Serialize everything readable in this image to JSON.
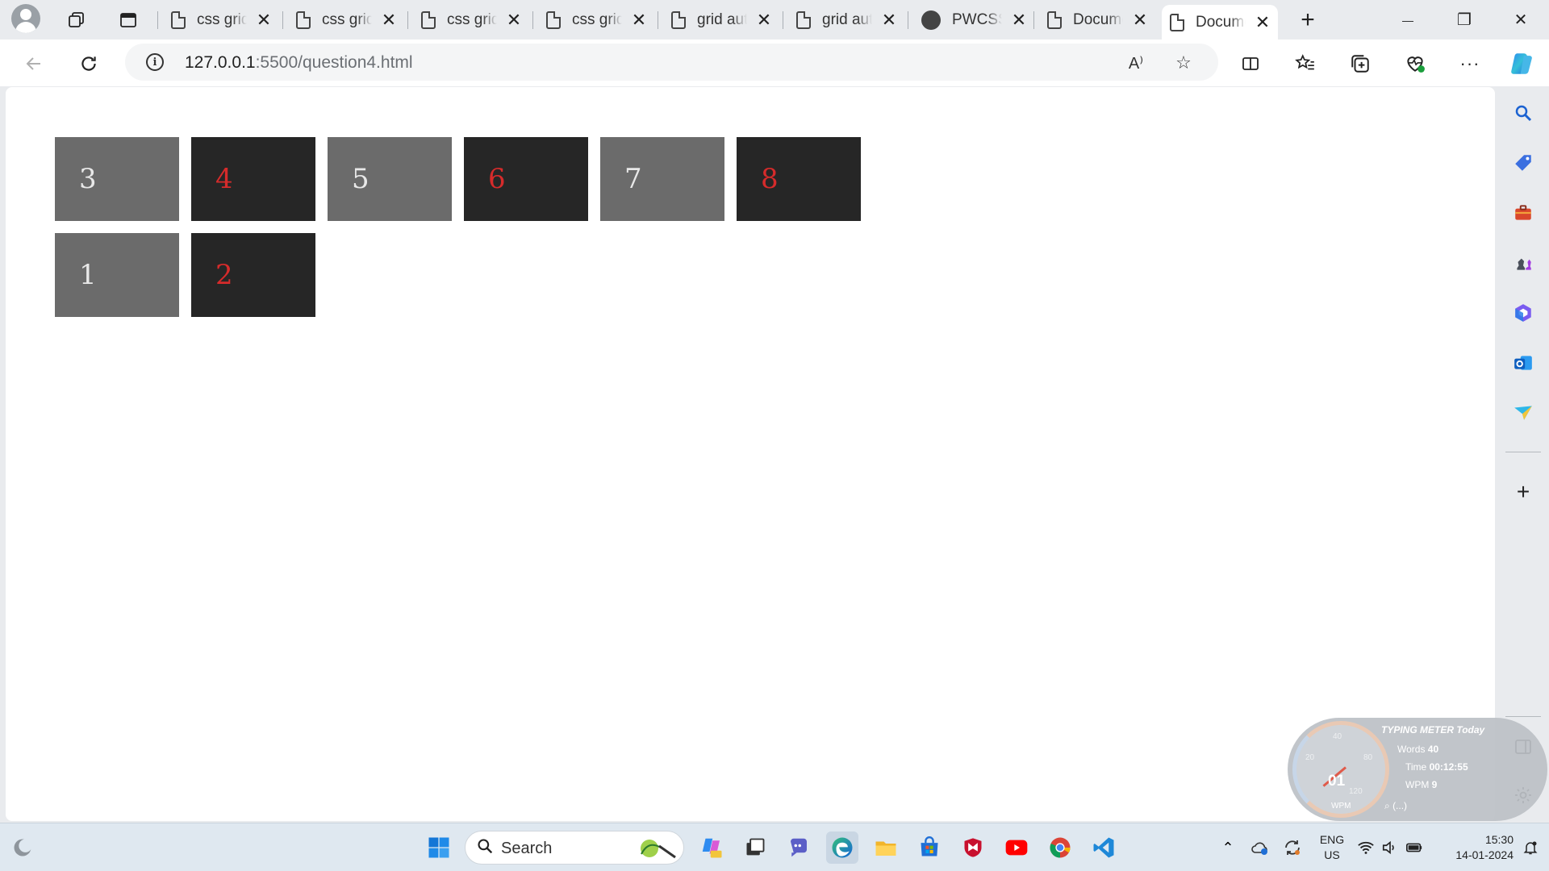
{
  "browser": {
    "tabs": [
      {
        "title": "css grid",
        "icon": "page-icon"
      },
      {
        "title": "css grid",
        "icon": "page-icon"
      },
      {
        "title": "css grid",
        "icon": "page-icon"
      },
      {
        "title": "css grid",
        "icon": "page-icon"
      },
      {
        "title": "grid auto",
        "icon": "page-icon"
      },
      {
        "title": "grid auto",
        "icon": "page-icon"
      },
      {
        "title": "PWCSS",
        "icon": "github-icon"
      },
      {
        "title": "Document",
        "icon": "page-icon"
      },
      {
        "title": "Document",
        "icon": "page-icon",
        "active": true
      }
    ],
    "new_tab_label": "+",
    "close_glyph": "✕",
    "window": {
      "minimize": "—",
      "restore": "❐",
      "close": "✕"
    }
  },
  "address_bar": {
    "url_host": "127.0.0.1",
    "url_rest": ":5500/question4.html",
    "info_glyph": "i",
    "read_aloud_glyph": "A⁾"
  },
  "page": {
    "row1": [
      {
        "label": "3",
        "style": "gray"
      },
      {
        "label": "4",
        "style": "dark"
      },
      {
        "label": "5",
        "style": "gray"
      },
      {
        "label": "6",
        "style": "dark"
      },
      {
        "label": "7",
        "style": "gray"
      },
      {
        "label": "8",
        "style": "dark"
      }
    ],
    "row2": [
      {
        "label": "1",
        "style": "gray"
      },
      {
        "label": "2",
        "style": "dark"
      }
    ],
    "colors": {
      "gray_box": "#6b6b6b",
      "dark_box": "#262626",
      "red_text": "#d62b2b",
      "light_text": "#e8e8e8"
    }
  },
  "typing_meter": {
    "title": "TYPING METER Today",
    "words_label": "Words",
    "words_value": "40",
    "time_label": "Time",
    "time_value": "00:12:55",
    "wpm_label": "WPM",
    "wpm_value": "9",
    "dial_value": "01",
    "dial_unit": "WPM",
    "ticks": [
      "20",
      "40",
      "80",
      "120"
    ],
    "footer": "(...)"
  },
  "taskbar": {
    "search_label": "Search",
    "language_line1": "ENG",
    "language_line2": "US",
    "time": "15:30",
    "date": "14-01-2024"
  }
}
